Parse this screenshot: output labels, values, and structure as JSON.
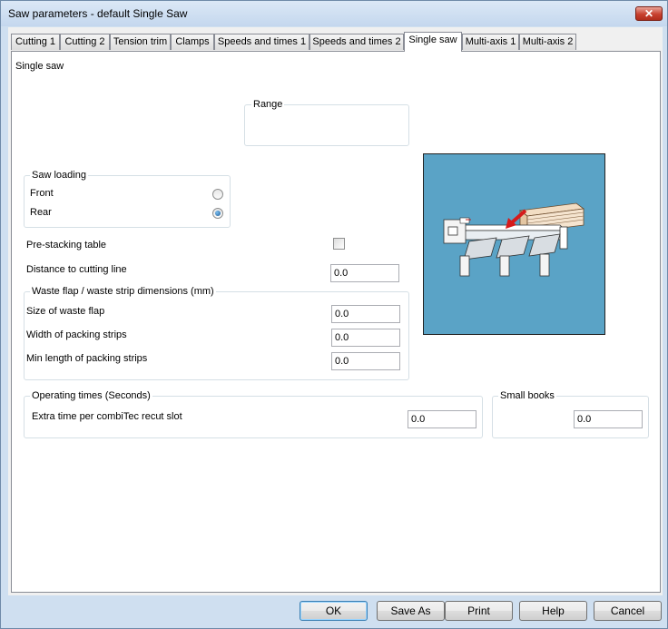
{
  "window": {
    "title": "Saw parameters - default Single Saw",
    "close_label": "✕"
  },
  "tabs": [
    {
      "label": "Cutting 1"
    },
    {
      "label": "Cutting 2"
    },
    {
      "label": "Tension trim"
    },
    {
      "label": "Clamps"
    },
    {
      "label": "Speeds and times 1"
    },
    {
      "label": "Speeds and times 2"
    },
    {
      "label": "Single saw"
    },
    {
      "label": "Multi-axis 1"
    },
    {
      "label": "Multi-axis 2"
    }
  ],
  "active_tab": "Single saw",
  "panel": {
    "heading": "Single saw",
    "range": {
      "label": "Range"
    },
    "saw_loading": {
      "label": "Saw loading",
      "options": [
        {
          "label": "Front",
          "checked": false
        },
        {
          "label": "Rear",
          "checked": true
        }
      ]
    },
    "pre_stacking_table": {
      "label": "Pre-stacking table",
      "checked": false
    },
    "distance_to_cutting_line": {
      "label": "Distance to cutting line",
      "value": "0.0"
    },
    "waste": {
      "label": "Waste flap / waste strip dimensions (mm)",
      "fields": [
        {
          "label": "Size of waste flap",
          "value": "0.0"
        },
        {
          "label": "Width of packing strips",
          "value": "0.0"
        },
        {
          "label": "Min length of packing strips",
          "value": "0.0"
        }
      ]
    },
    "operating_times": {
      "label": "Operating times (Seconds)",
      "field": {
        "label": "Extra time per combiTec recut slot",
        "value": "0.0"
      }
    },
    "small_books": {
      "label": "Small books",
      "value": "0.0"
    },
    "preview": {
      "icon": "saw-machine-illustration",
      "background": "#5aa3c6",
      "arrow_color": "#d61a1a"
    }
  },
  "buttons": {
    "ok": "OK",
    "save_as": "Save As",
    "print": "Print",
    "help": "Help",
    "cancel": "Cancel"
  }
}
